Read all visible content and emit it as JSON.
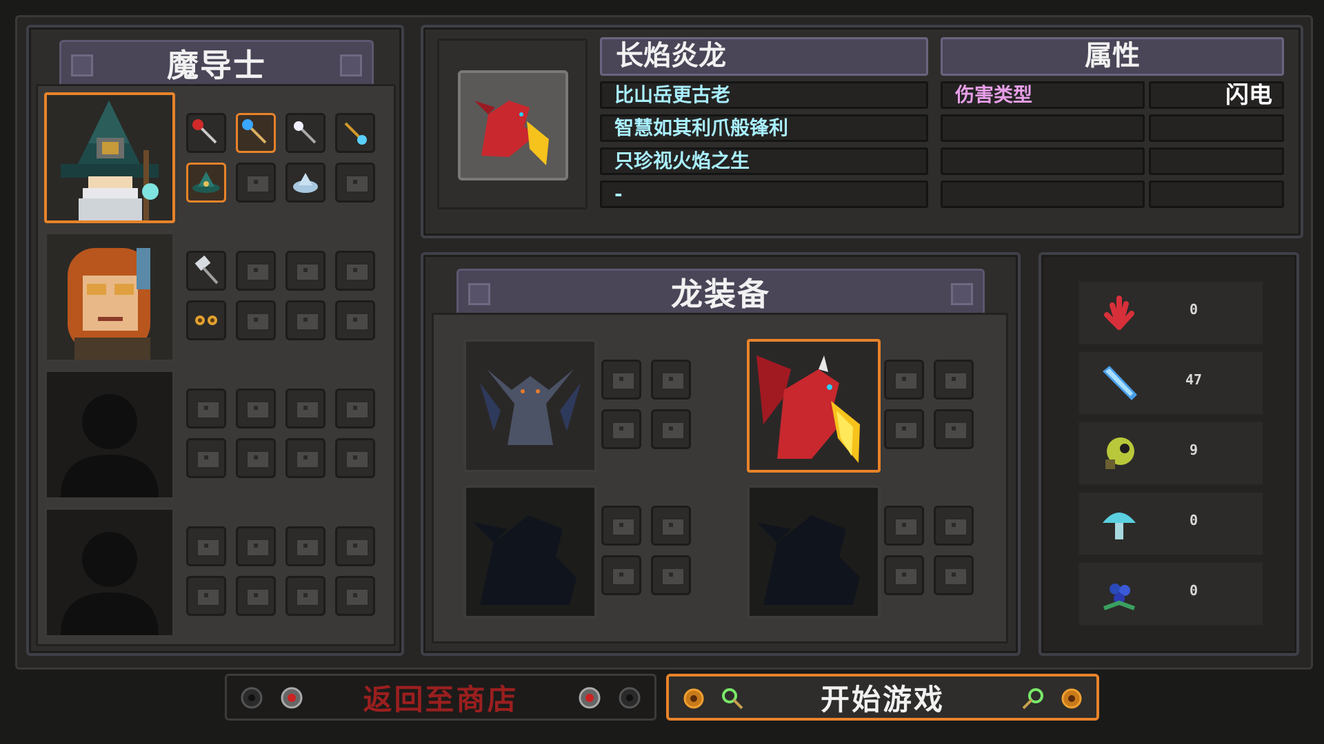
{
  "party_panel": {
    "title": "魔导士"
  },
  "info": {
    "dragon_name": "长焰炎龙",
    "lines": [
      "比山岳更古老",
      "智慧如其利爪般锋利",
      "只珍视火焰之生",
      "-"
    ],
    "attr_title": "属性",
    "attributes": [
      {
        "key": "伤害类型",
        "value": "闪电"
      },
      {
        "key": "",
        "value": ""
      },
      {
        "key": "",
        "value": ""
      },
      {
        "key": "",
        "value": ""
      }
    ]
  },
  "dragon_panel": {
    "title": "龙装备"
  },
  "resources": [
    {
      "icon": "red-coral-icon",
      "value": "0"
    },
    {
      "icon": "blue-crystal-icon",
      "value": "47"
    },
    {
      "icon": "eye-orb-icon",
      "value": "9"
    },
    {
      "icon": "mushroom-icon",
      "value": "0"
    },
    {
      "icon": "berry-cluster-icon",
      "value": "0"
    }
  ],
  "buttons": {
    "back": "返回至商店",
    "start": "开始游戏"
  },
  "colors": {
    "accent_orange": "#e8832a",
    "back_text": "#9b1f1f",
    "info_text": "#a9f0ff",
    "attr_key_text": "#e89fe8"
  }
}
